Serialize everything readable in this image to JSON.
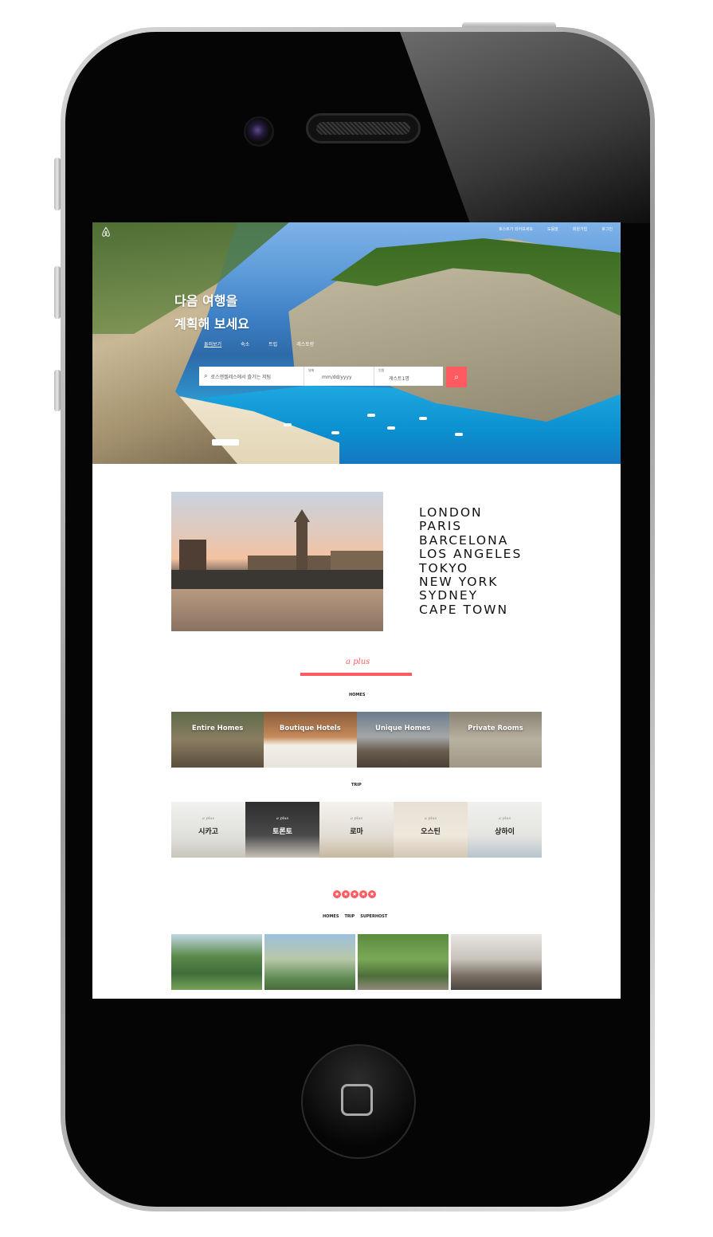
{
  "nav": {
    "links": [
      "호스트가 되어보세요",
      "도움말",
      "회원가입",
      "로그인"
    ]
  },
  "hero": {
    "title": "다음 여행을\n계획해 보세요",
    "tabs": [
      "둘러보기",
      "숙소",
      "트립",
      "레스토랑"
    ]
  },
  "search": {
    "where": "로스앤젤레스에서 즐기는 저팀",
    "date_label": "날짜",
    "date_value": "mm/dd/yyyy",
    "guests_label": "인원",
    "guests_value": "게스트1명"
  },
  "cities": [
    "LONDON",
    "PARIS",
    "BARCELONA",
    "LOS ANGELES",
    "TOKYO",
    "NEW YORK",
    "SYDNEY",
    "CAPE TOWN"
  ],
  "plus": {
    "script": "a plus"
  },
  "homes": {
    "label": "HOMES",
    "tiles": [
      "Entire Homes",
      "Boutique Hotels",
      "Unique Homes",
      "Private Rooms"
    ]
  },
  "trip": {
    "label": "TRIP",
    "tile_script": "a plus",
    "tiles": [
      "시카고",
      "토론토",
      "로마",
      "오스틴",
      "상하이"
    ]
  },
  "superhost": {
    "tabs": [
      "HOMES",
      "TRIP",
      "SUPERHOST"
    ]
  },
  "colors": {
    "accent": "#ff5a5f"
  }
}
